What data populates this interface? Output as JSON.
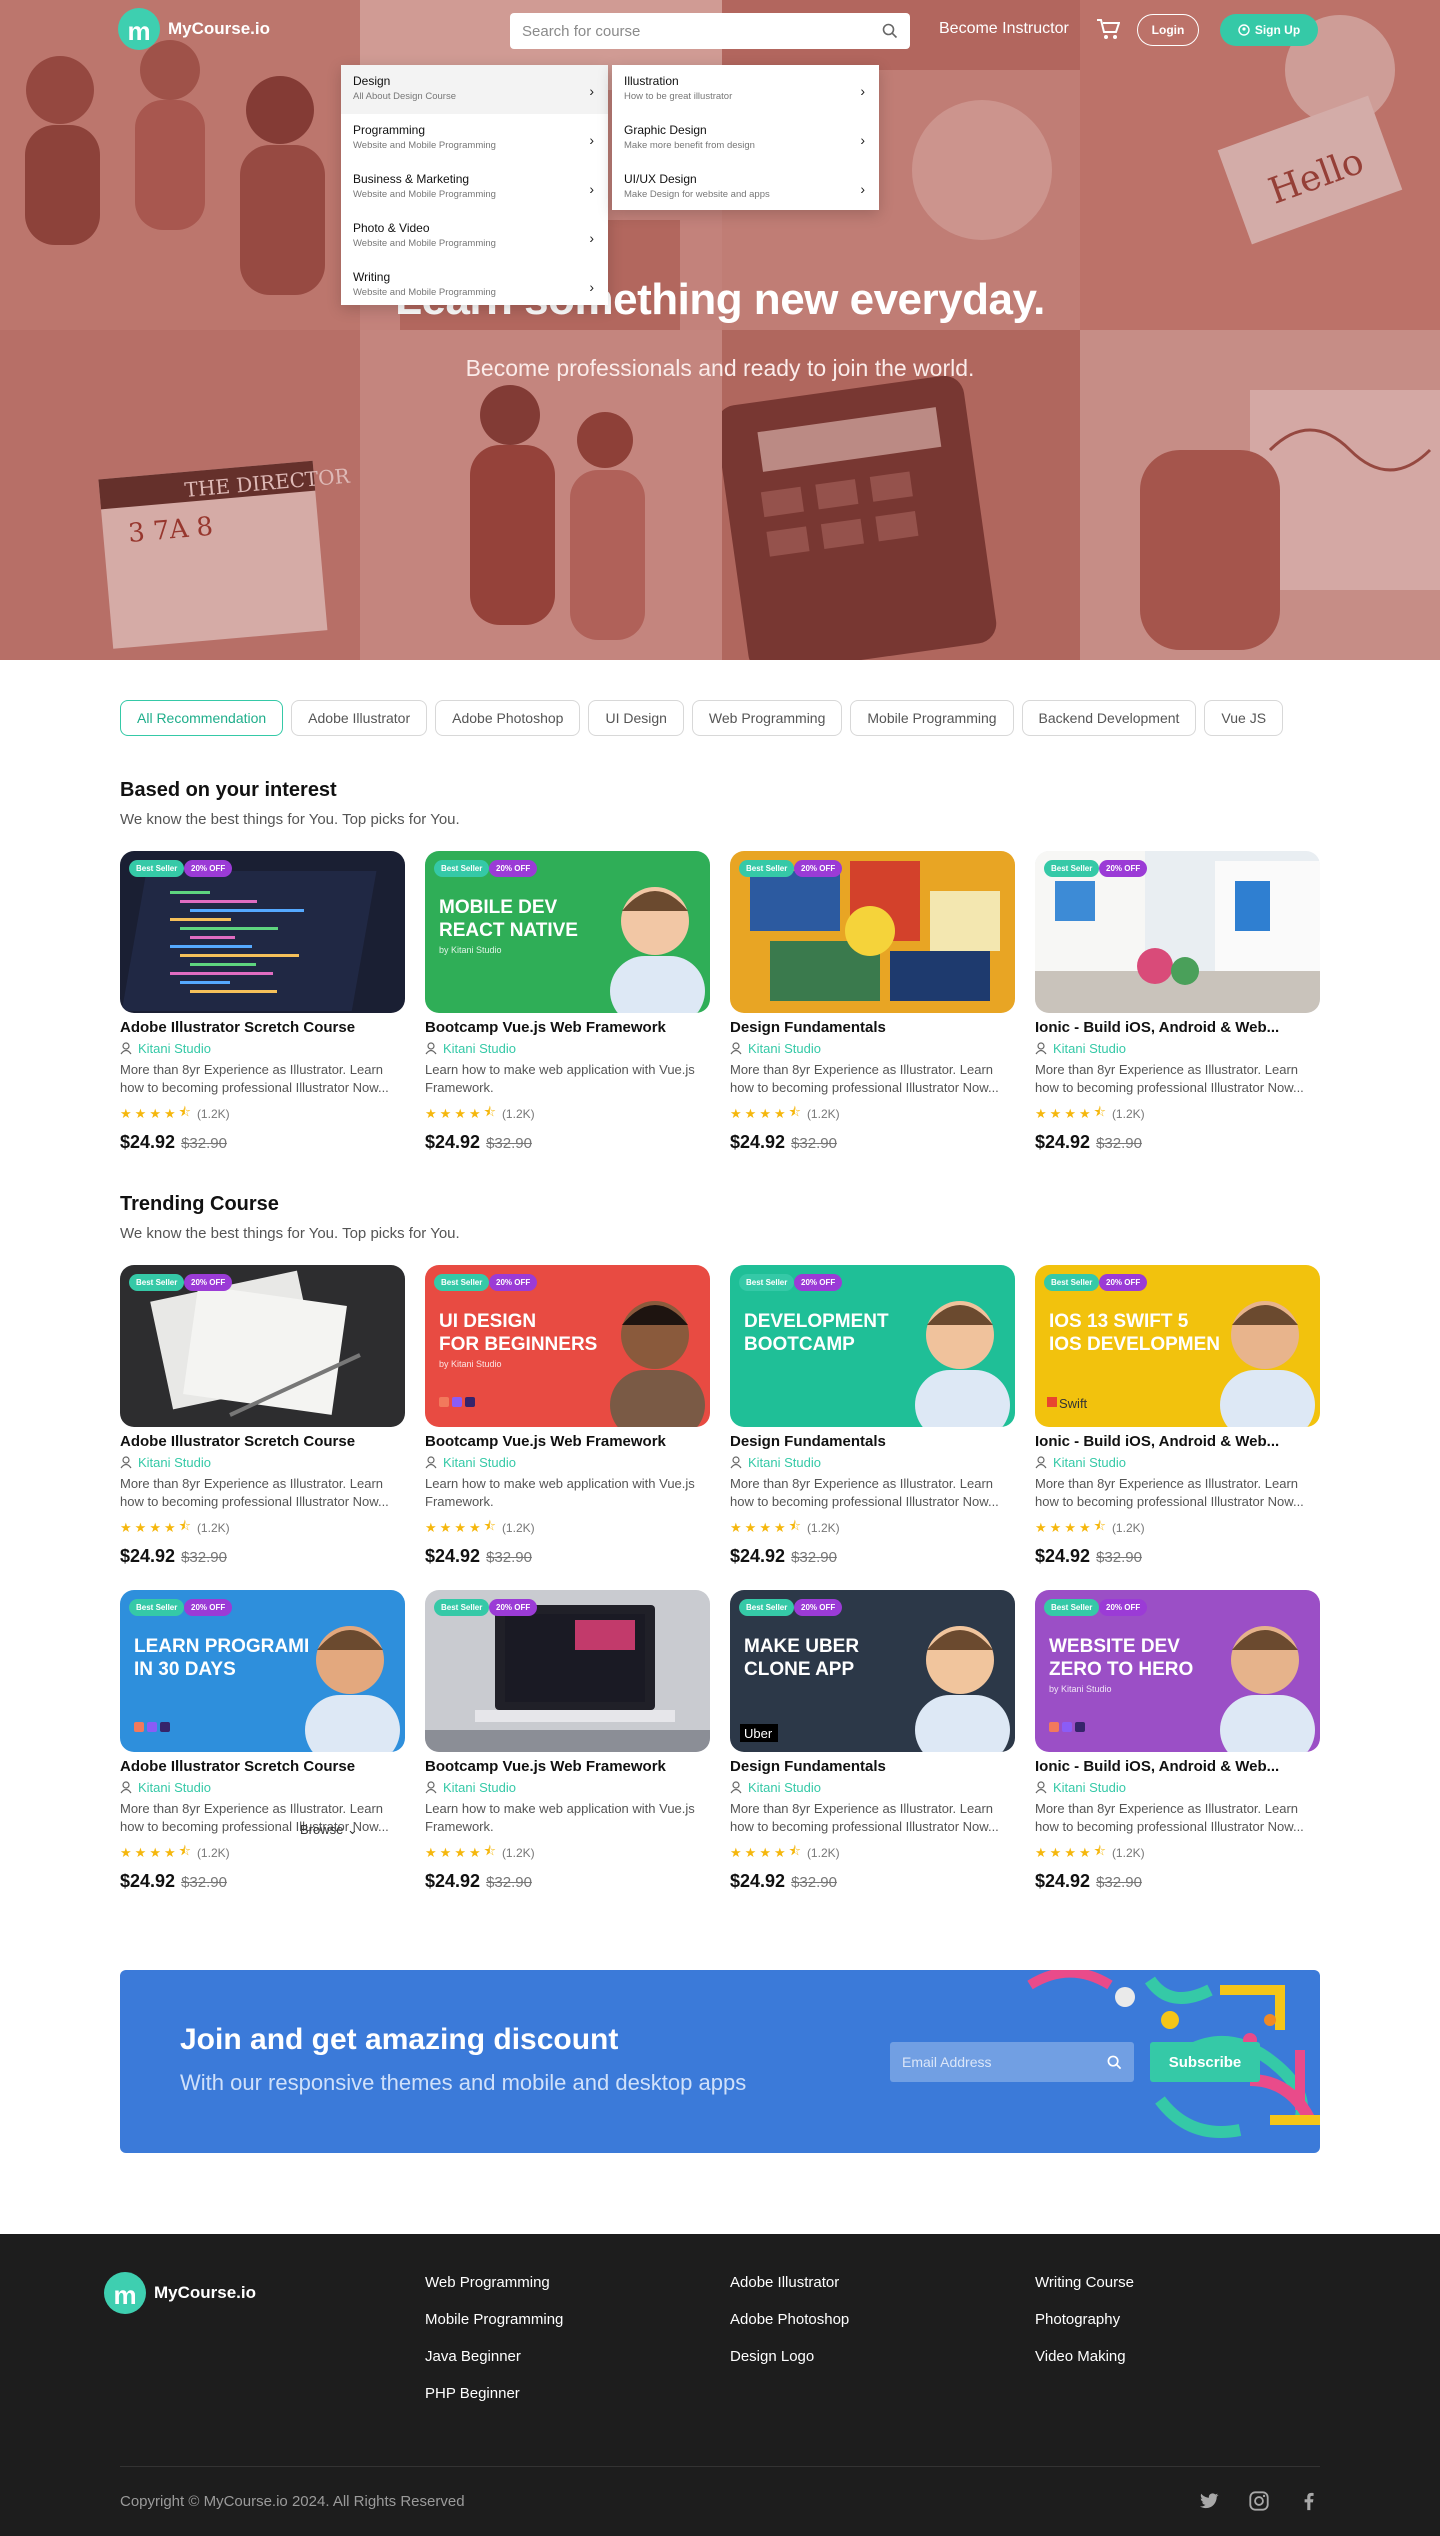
{
  "brand": {
    "name": "MyCourse.io",
    "accent": "#35c9a7"
  },
  "nav": {
    "search_placeholder": "Search for course",
    "become_instructor": "Become Instructor",
    "login": "Login",
    "signup": "Sign Up"
  },
  "dropdown": {
    "left": [
      {
        "title": "Design",
        "desc": "All About Design Course"
      },
      {
        "title": "Programming",
        "desc": "Website and Mobile Programming"
      },
      {
        "title": "Business & Marketing",
        "desc": "Website and Mobile Programming"
      },
      {
        "title": "Photo & Video",
        "desc": "Website and Mobile Programming"
      },
      {
        "title": "Writing",
        "desc": "Website and Mobile Programming"
      }
    ],
    "right": [
      {
        "title": "Illustration",
        "desc": "How to be great illustrator"
      },
      {
        "title": "Graphic Design",
        "desc": "Make more benefit from design"
      },
      {
        "title": "UI/UX Design",
        "desc": "Make Design for website and apps"
      }
    ]
  },
  "hero": {
    "title": "Learn something new everyday.",
    "subtitle": "Become professionals and ready to join the world."
  },
  "filters": [
    "All Recommendation",
    "Adobe Illustrator",
    "Adobe Photoshop",
    "UI Design",
    "Web Programming",
    "Mobile Programming",
    "Backend Development",
    "Vue JS"
  ],
  "sections": {
    "interest": {
      "title": "Based on your interest",
      "subtitle": "We know the best things for You.  Top picks for You."
    },
    "trending": {
      "title": "Trending Course",
      "subtitle": "We know the best things for You.  Top picks for You."
    }
  },
  "badges": {
    "best_seller": "Best Seller",
    "discount": "20% OFF"
  },
  "thumb_texts": {
    "mobile": "MOBILE DEV\nREACT NATIVE",
    "ui": "UI DESIGN\nFOR BEGINNERS",
    "dev": "DEVELOPMENT\nBOOTCAMP",
    "ios": "IOS 13 SWIFT 5\nIOS DEVELOPMEN",
    "prog": "LEARN PROGRAMI\nIN 30 DAYS",
    "uber": "MAKE UBER\nCLONE APP",
    "web": "WEBSITE DEV\nZERO TO HERO",
    "by": "by Kitani Studio",
    "swift": "Swift",
    "uber_logo": "Uber"
  },
  "courses": [
    {
      "title": "Adobe Illustrator Scretch Course",
      "author": "Kitani Studio",
      "desc": "More than 8yr Experience as Illustrator. Learn how to becoming professional Illustrator Now...",
      "rating": 4.5,
      "reviews": "(1.2K)",
      "price": "$24.92",
      "old_price": "$32.90"
    },
    {
      "title": "Bootcamp  Vue.js Web Framework",
      "author": "Kitani Studio",
      "desc": "Learn how to make web application with Vue.js Framework.",
      "rating": 4.5,
      "reviews": "(1.2K)",
      "price": "$24.92",
      "old_price": "$32.90"
    },
    {
      "title": "Design Fundamentals",
      "author": "Kitani Studio",
      "desc": "More than 8yr Experience as Illustrator. Learn how to becoming professional Illustrator Now...",
      "rating": 4.5,
      "reviews": "(1.2K)",
      "price": "$24.92",
      "old_price": "$32.90"
    },
    {
      "title": "Ionic - Build iOS, Android & Web...",
      "author": "Kitani Studio",
      "desc": "More than 8yr Experience as Illustrator. Learn how to becoming professional Illustrator Now...",
      "rating": 4.5,
      "reviews": "(1.2K)",
      "price": "$24.92",
      "old_price": "$32.90"
    }
  ],
  "browse": "Browse",
  "newsletter": {
    "title": "Join and get amazing discount",
    "subtitle": "With our responsive themes and mobile and desktop apps",
    "placeholder": "Email Address",
    "button": "Subscribe"
  },
  "footer": {
    "col1": [
      "Web Programming",
      "Mobile Programming",
      "Java Beginner",
      "PHP Beginner"
    ],
    "col2": [
      "Adobe Illustrator",
      "Adobe Photoshop",
      "Design Logo"
    ],
    "col3": [
      "Writing Course",
      "Photography",
      "Video Making"
    ],
    "copyright": "Copyright © MyCourse.io 2024. All Rights Reserved",
    "social": [
      "twitter-icon",
      "instagram-icon",
      "facebook-icon"
    ]
  }
}
